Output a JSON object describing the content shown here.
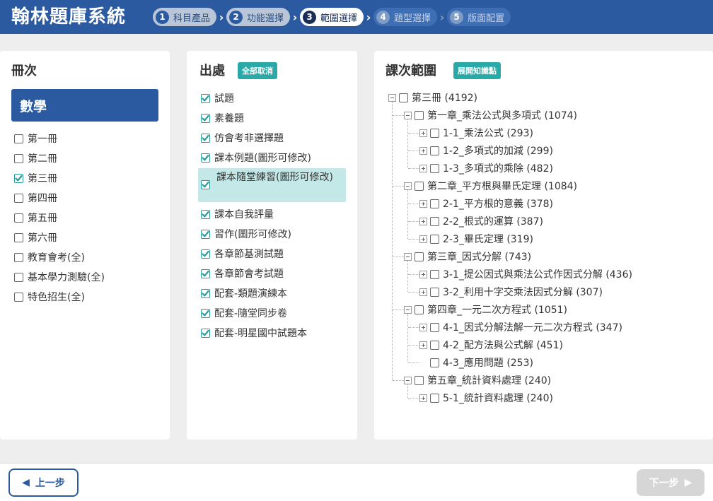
{
  "app": {
    "title": "翰林題庫系統"
  },
  "steps": [
    {
      "num": "1",
      "label": "科目產品",
      "state": "done"
    },
    {
      "num": "2",
      "label": "功能選擇",
      "state": "done"
    },
    {
      "num": "3",
      "label": "範圍選擇",
      "state": "active"
    },
    {
      "num": "4",
      "label": "題型選擇",
      "state": "todo"
    },
    {
      "num": "5",
      "label": "版面配置",
      "state": "todo"
    }
  ],
  "books": {
    "title": "冊次",
    "subject": "數學",
    "items": [
      {
        "label": "第一冊",
        "checked": false
      },
      {
        "label": "第二冊",
        "checked": false
      },
      {
        "label": "第三冊",
        "checked": true
      },
      {
        "label": "第四冊",
        "checked": false
      },
      {
        "label": "第五冊",
        "checked": false
      },
      {
        "label": "第六冊",
        "checked": false
      },
      {
        "label": "教育會考(全)",
        "checked": false
      },
      {
        "label": "基本學力測驗(全)",
        "checked": false
      },
      {
        "label": "特色招生(全)",
        "checked": false
      }
    ]
  },
  "sources": {
    "title": "出處",
    "toggle_label": "全部取消",
    "items": [
      {
        "label": "試題",
        "checked": true
      },
      {
        "label": "素養題",
        "checked": true
      },
      {
        "label": "仿會考非選擇題",
        "checked": true
      },
      {
        "label": "課本例題(圖形可修改)",
        "checked": true
      },
      {
        "label": "課本隨堂練習(圖形可修改)",
        "checked": true,
        "highlighted": true
      },
      {
        "label": "課本自我評量",
        "checked": true
      },
      {
        "label": "習作(圖形可修改)",
        "checked": true
      },
      {
        "label": "各章節基測試題",
        "checked": true
      },
      {
        "label": "各章節會考試題",
        "checked": true
      },
      {
        "label": "配套-類題演練本",
        "checked": true
      },
      {
        "label": "配套-隨堂同步卷",
        "checked": true
      },
      {
        "label": "配套-明星國中試題本",
        "checked": true
      }
    ]
  },
  "lessons": {
    "title": "課次範圍",
    "expand_label": "展開知識點",
    "tree": [
      {
        "level": 0,
        "toggle": "minus",
        "label": "第三冊 (4192)"
      },
      {
        "level": 1,
        "toggle": "minus",
        "label": "第一章_乘法公式與多項式 (1074)"
      },
      {
        "level": 2,
        "toggle": "plus",
        "label": "1-1_乘法公式 (293)"
      },
      {
        "level": 2,
        "toggle": "plus",
        "label": "1-2_多項式的加減 (299)"
      },
      {
        "level": 2,
        "toggle": "plus",
        "label": "1-3_多項式的乘除 (482)"
      },
      {
        "level": 1,
        "toggle": "minus",
        "label": "第二章_平方根與畢氏定理 (1084)"
      },
      {
        "level": 2,
        "toggle": "plus",
        "label": "2-1_平方根的意義 (378)"
      },
      {
        "level": 2,
        "toggle": "plus",
        "label": "2-2_根式的運算 (387)"
      },
      {
        "level": 2,
        "toggle": "plus",
        "label": "2-3_畢氏定理 (319)"
      },
      {
        "level": 1,
        "toggle": "minus",
        "label": "第三章_因式分解 (743)"
      },
      {
        "level": 2,
        "toggle": "plus",
        "label": "3-1_提公因式與乘法公式作因式分解 (436)"
      },
      {
        "level": 2,
        "toggle": "plus",
        "label": "3-2_利用十字交乘法因式分解 (307)"
      },
      {
        "level": 1,
        "toggle": "minus",
        "label": "第四章_一元二次方程式 (1051)"
      },
      {
        "level": 2,
        "toggle": "plus",
        "label": "4-1_因式分解法解一元二次方程式 (347)"
      },
      {
        "level": 2,
        "toggle": "plus",
        "label": "4-2_配方法與公式解 (451)"
      },
      {
        "level": 2,
        "toggle": "none",
        "label": "4-3_應用問題 (253)"
      },
      {
        "level": 1,
        "toggle": "minus",
        "label": "第五章_統計資料處理 (240)"
      },
      {
        "level": 2,
        "toggle": "plus",
        "label": "5-1_統計資料處理 (240)"
      }
    ]
  },
  "footer": {
    "prev_label": "上一步",
    "next_label": "下一步"
  },
  "colors": {
    "brand": "#2c5aa0",
    "accent": "#2aa9a9",
    "highlight": "#c4e8e8",
    "disabled": "#d6d6d6"
  }
}
